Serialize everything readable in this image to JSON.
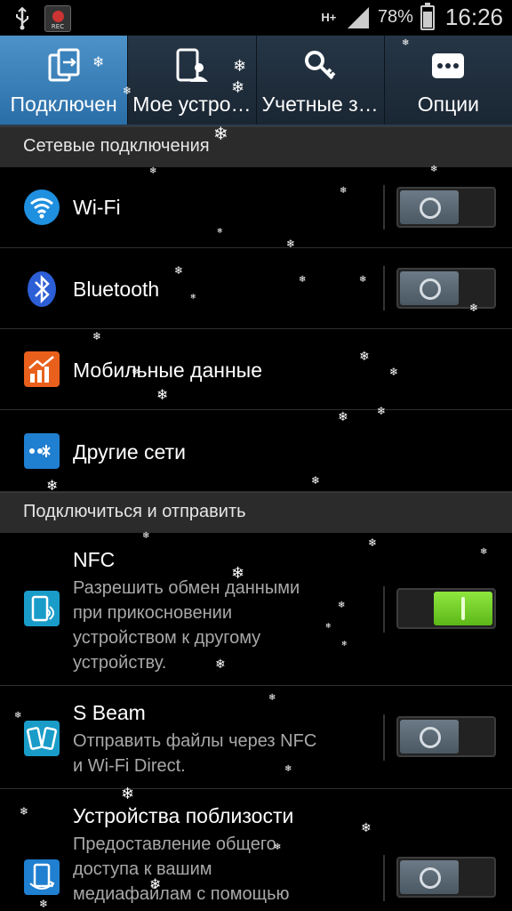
{
  "status_bar": {
    "network_type": "H+",
    "battery_percent": "78%",
    "time": "16:26",
    "rec_label": "REC",
    "icons": [
      "usb-icon",
      "screen-recorder-icon",
      "network-icon",
      "signal-icon",
      "battery-charging-icon"
    ]
  },
  "tabs": [
    {
      "label": "Подключен",
      "icon": "connections-icon",
      "active": true
    },
    {
      "label": "Мое устро…",
      "icon": "my-device-icon",
      "active": false
    },
    {
      "label": "Учетные з…",
      "icon": "accounts-key-icon",
      "active": false
    },
    {
      "label": "Опции",
      "icon": "more-options-icon",
      "active": false
    }
  ],
  "sections": {
    "network_connections": "Сетевые подключения",
    "connect_and_share": "Подключиться и отправить"
  },
  "rows": {
    "wifi": {
      "title": "Wi-Fi",
      "toggle": "off"
    },
    "bluetooth": {
      "title": "Bluetooth",
      "toggle": "off"
    },
    "mobile_data": {
      "title": "Мобильные данные"
    },
    "other_networks": {
      "title": "Другие сети"
    },
    "nfc": {
      "title": "NFC",
      "desc_lines": [
        "Разрешить обмен данными",
        "при прикосновении",
        "устройством к другому",
        "устройству."
      ],
      "toggle": "on"
    },
    "s_beam": {
      "title": "S Beam",
      "desc_lines": [
        "Отправить файлы через NFC",
        "и Wi-Fi Direct."
      ],
      "toggle": "off"
    },
    "nearby_devices": {
      "title": "Устройства поблизости",
      "desc_lines": [
        "Предоставление общего",
        "доступа к вашим",
        "медиафайлам с помощью"
      ],
      "toggle": "off"
    }
  },
  "colors": {
    "active_tab": "#3a82bb",
    "toggle_on": "#78d42a",
    "section_bg": "#2b2b2b"
  }
}
